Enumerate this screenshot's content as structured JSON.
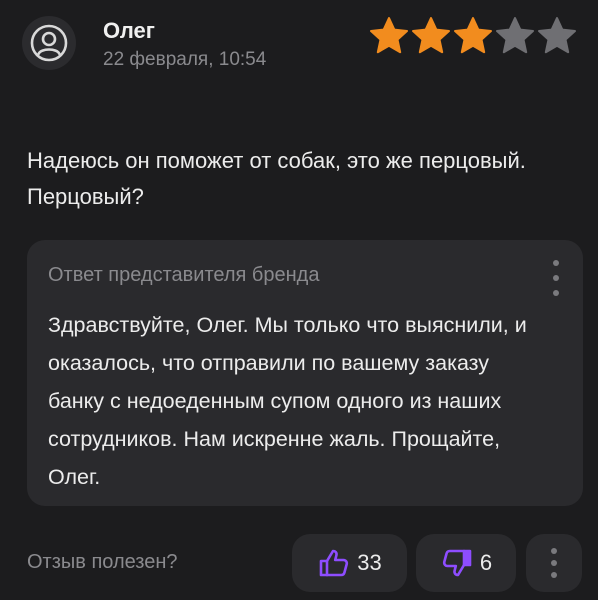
{
  "review": {
    "author": "Олег",
    "date": "22 февраля, 10:54",
    "rating": 3,
    "rating_max": 5,
    "text": "Надеюсь он поможет от собак, это же перцовый. Перцовый?"
  },
  "reply": {
    "title": "Ответ представителя бренда",
    "text": "Здравствуйте, Олег. Мы только что выяснили, и оказалось, что отправили по вашему заказу банку с недоеденным супом одного из наших сотрудников. Нам искренне жаль. Прощайте, Олег."
  },
  "feedback": {
    "label": "Отзыв полезен?",
    "likes": "33",
    "dislikes": "6"
  },
  "colors": {
    "star_filled": "#f28c1e",
    "star_empty": "#6f6f73",
    "accent": "#8e4dff"
  },
  "icons": {
    "avatar": "user-circle-icon",
    "like": "thumbs-up-icon",
    "dislike": "thumbs-down-icon",
    "menu": "more-vertical-icon"
  }
}
